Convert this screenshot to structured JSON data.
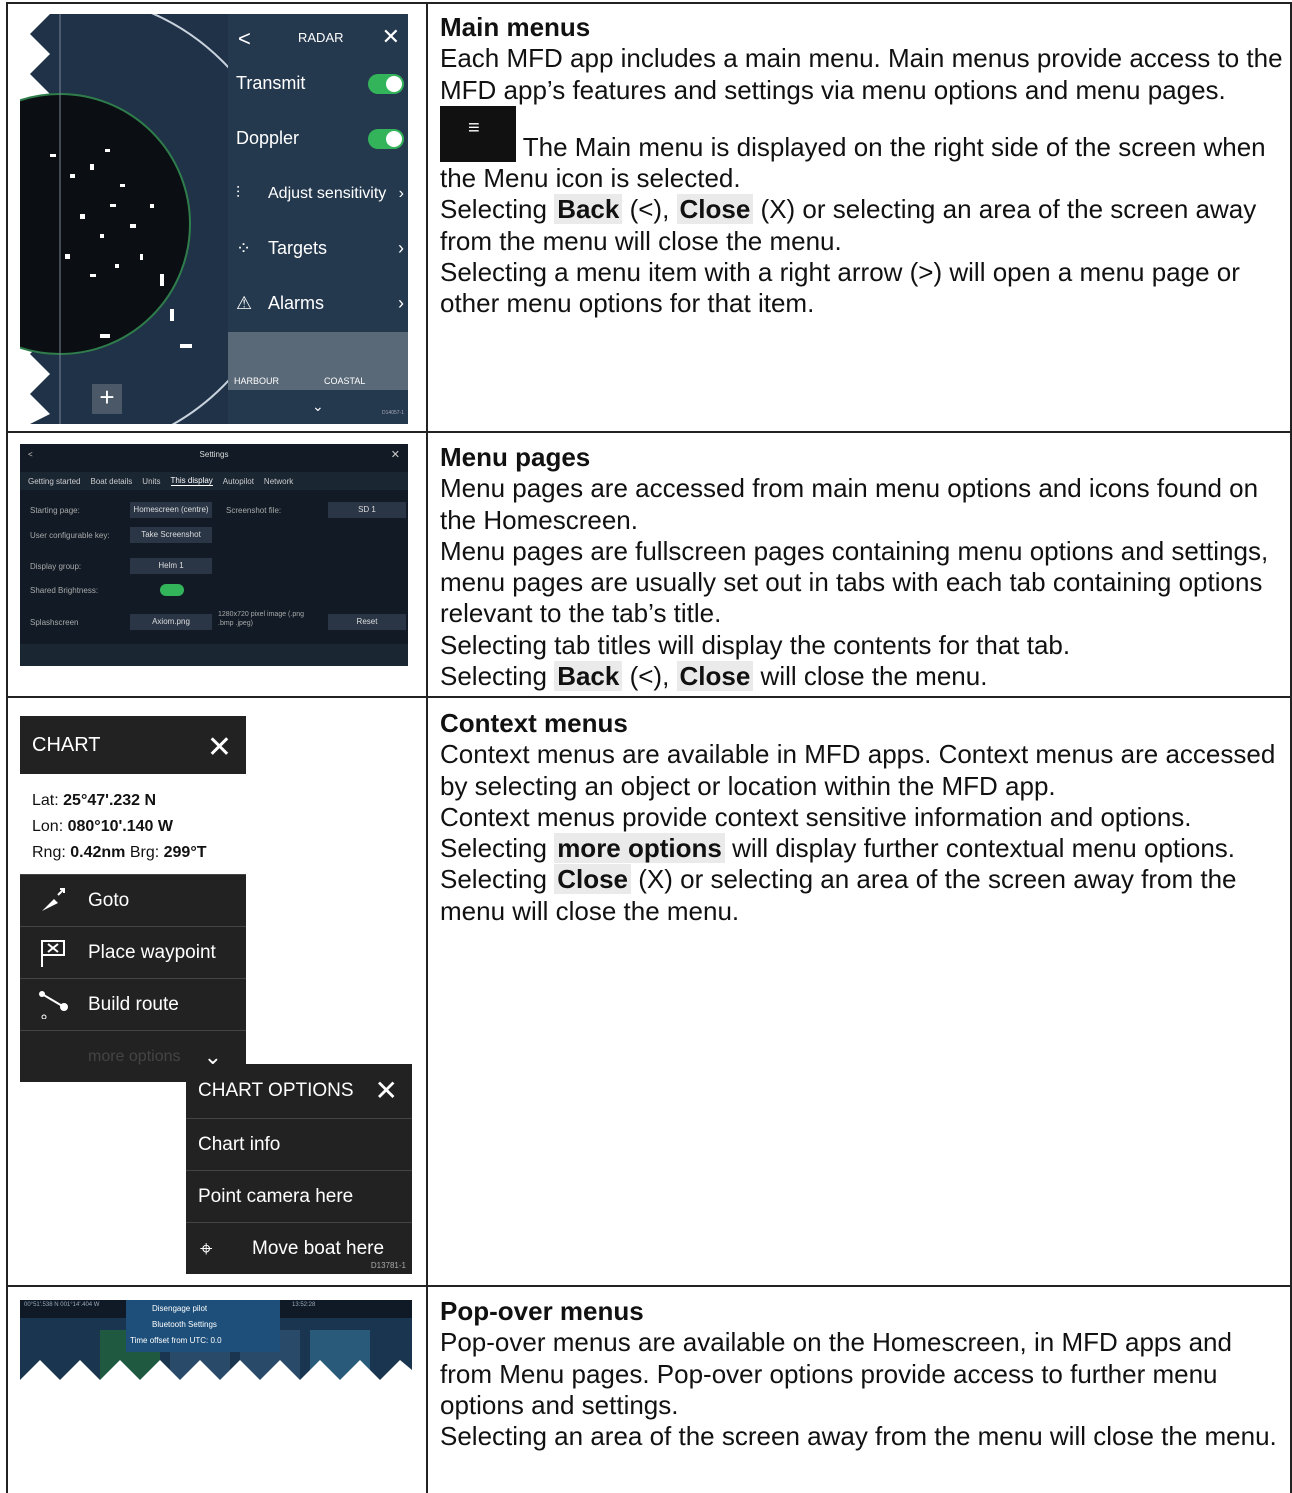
{
  "rows": [
    {
      "heading": "Main menus",
      "p1": "Each MFD app includes a main menu. Main menus provide access to the MFD app’s features and settings via menu options and menu pages.",
      "p2": " The Main menu is displayed on the right side of the screen when the Menu icon is selected.",
      "p3_a": "Selecting ",
      "p3_back": "Back",
      "p3_b": " (<), ",
      "p3_close": "Close",
      "p3_c": " (X) or selecting an area of the screen away from the menu will close the menu.",
      "p4": "Selecting a menu item with a right arrow (>) will open a menu page or other menu options for that item."
    },
    {
      "heading": "Menu pages",
      "p1": "Menu pages are accessed from main menu options and icons found on the Homescreen.",
      "p2": "Menu pages are fullscreen pages containing menu options and settings, menu pages are usually set out in tabs with each tab containing options relevant to the tab’s title.",
      "p3": "Selecting tab titles will display the contents for that tab.",
      "p4_a": "Selecting ",
      "p4_back": "Back",
      "p4_b": " (<), ",
      "p4_close": "Close",
      "p4_c": " will close the menu."
    },
    {
      "heading": "Context menus",
      "p1": "Context menus are available in MFD apps.  Context menus are accessed by selecting an object or location within the MFD app.",
      "p2": "Context menus provide context sensitive information and options.",
      "p3_a": "Selecting ",
      "p3_more": "more options",
      "p3_b": " will display further contextual menu options.",
      "p4_a": "Selecting ",
      "p4_close": "Close",
      "p4_b": " (X) or selecting an area of the screen away from the menu will close the menu."
    },
    {
      "heading": "Pop-over menus",
      "p1": "Pop-over menus are available on the Homescreen, in MFD apps and from Menu pages. Pop-over options provide access to further menu options and settings.",
      "p2": "Selecting an area of the screen away from the menu will close the menu."
    }
  ],
  "radar": {
    "title": "RADAR",
    "back": "<",
    "close": "✕",
    "items": [
      "Transmit",
      "Doppler",
      "Adjust sensitivity",
      "Targets",
      "Alarms"
    ],
    "preset_1": "HARBOUR",
    "preset_2": "COASTAL",
    "plus": "+",
    "code": "D14057-1"
  },
  "settings": {
    "title": "Settings",
    "tabs": [
      "Getting started",
      "Boat details",
      "Units",
      "This display",
      "Autopilot",
      "Network"
    ],
    "starting_page_label": "Starting page:",
    "starting_page_value": "Homescreen (centre)",
    "screenshot_label": "Screenshot file:",
    "screenshot_value": "SD 1",
    "user_key_label": "User configurable key:",
    "user_key_value": "Take Screenshot",
    "display_group_label": "Display group:",
    "display_group_value": "Helm 1",
    "shared_brightness_label": "Shared Brightness:",
    "splash_label": "Splashscreen",
    "splash_value": "Axiom.png",
    "splash_note": "1280x720 pixel image (.png .bmp .jpeg)",
    "reset": "Reset"
  },
  "chart_ctx": {
    "title": "CHART",
    "lat_label": "Lat: ",
    "lat": "25°47'.232 N",
    "lon_label": "Lon: ",
    "lon": "080°10'.140 W",
    "rng_label": "Rng: ",
    "rng": "0.42nm",
    "brg_label": " Brg: ",
    "brg": "299°T",
    "items": [
      "Goto",
      "Place waypoint",
      "Build route"
    ],
    "more": "more options",
    "options_title": "CHART OPTIONS",
    "options": [
      "Chart info",
      "Point camera here",
      "Move boat here"
    ],
    "code": "D13781-1"
  },
  "popover": {
    "status": "00°51'.538 N  001°14'.404 W",
    "item1": "Disengage pilot",
    "item2": "Bluetooth Settings",
    "item3": "Time offset from UTC: 0.0",
    "time": "13:52:28"
  }
}
